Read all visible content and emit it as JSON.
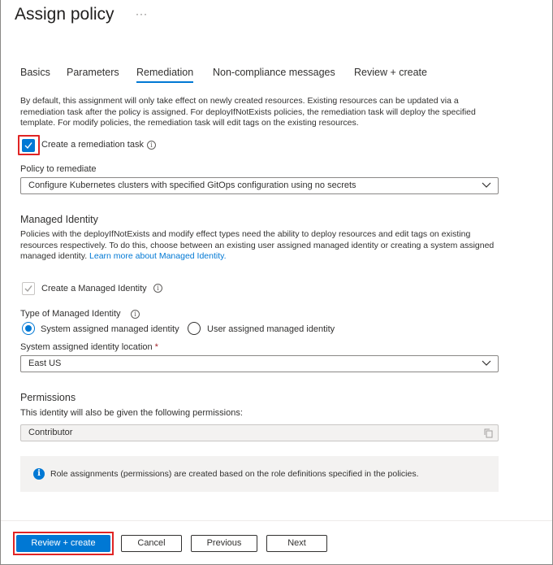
{
  "header": {
    "title": "Assign policy",
    "more": "···"
  },
  "tabs": [
    {
      "label": "Basics",
      "active": false
    },
    {
      "label": "Parameters",
      "active": false
    },
    {
      "label": "Remediation",
      "active": true
    },
    {
      "label": "Non-compliance messages",
      "active": false
    },
    {
      "label": "Review + create",
      "active": false
    }
  ],
  "remediation": {
    "description": "By default, this assignment will only take effect on newly created resources. Existing resources can be updated via a remediation task after the policy is assigned. For deployIfNotExists policies, the remediation task will deploy the specified template. For modify policies, the remediation task will edit tags on the existing resources.",
    "create_task_label": "Create a remediation task",
    "create_task_checked": true,
    "policy_label": "Policy to remediate",
    "policy_value": "Configure Kubernetes clusters with specified GitOps configuration using no secrets"
  },
  "managed_identity": {
    "title": "Managed Identity",
    "description": "Policies with the deployIfNotExists and modify effect types need the ability to deploy resources and edit tags on existing resources respectively. To do this, choose between an existing user assigned managed identity or creating a system assigned managed identity.",
    "learn_more": "Learn more about Managed Identity.",
    "create_label": "Create a Managed Identity",
    "create_checked": true,
    "type_label": "Type of Managed Identity",
    "type_options": [
      "System assigned managed identity",
      "User assigned managed identity"
    ],
    "type_selected": "System assigned managed identity",
    "location_label": "System assigned identity location",
    "required_mark": "*",
    "location_value": "East US"
  },
  "permissions": {
    "title": "Permissions",
    "description": "This identity will also be given the following permissions:",
    "value": "Contributor",
    "info": "Role assignments (permissions) are created based on the role definitions specified in the policies."
  },
  "footer": {
    "review_create": "Review + create",
    "cancel": "Cancel",
    "previous": "Previous",
    "next": "Next"
  },
  "colors": {
    "accent": "#0078d4",
    "highlight": "#e02424"
  }
}
